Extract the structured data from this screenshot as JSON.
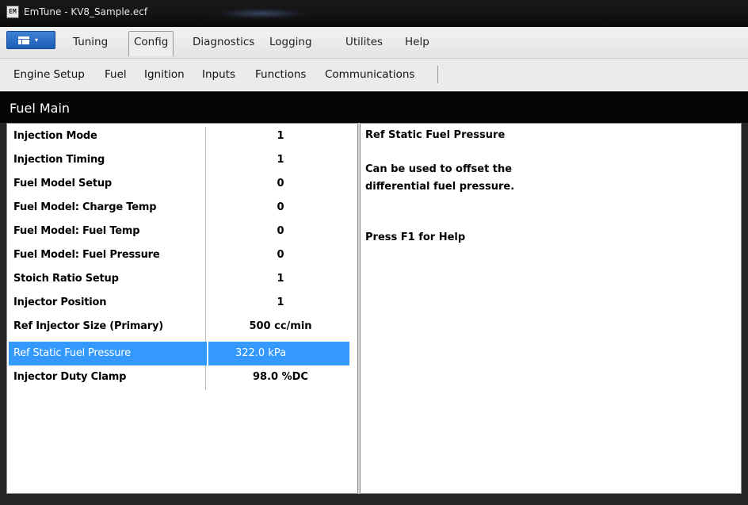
{
  "window": {
    "icon_text": "EM",
    "title": "EmTune  -  KV8_Sample.ecf"
  },
  "ribbon": {
    "app_menu": {
      "icon": "document-menu-icon",
      "caret": "▾",
      "color": "#2a6fcf"
    },
    "tabs": [
      {
        "label": "Tuning",
        "active": false
      },
      {
        "label": "Config",
        "active": true
      },
      {
        "label": "Diagnostics",
        "active": false
      },
      {
        "label": "Logging",
        "active": false
      },
      {
        "label": "Utilites",
        "active": false
      },
      {
        "label": "Help",
        "active": false
      }
    ]
  },
  "submenu": {
    "items": [
      {
        "label": "Engine Setup"
      },
      {
        "label": "Fuel"
      },
      {
        "label": "Ignition"
      },
      {
        "label": "Inputs"
      },
      {
        "label": "Functions"
      },
      {
        "label": "Communications"
      }
    ]
  },
  "panel": {
    "title": "Fuel Main"
  },
  "parameters": [
    {
      "name": "Injection Mode",
      "value": "1"
    },
    {
      "name": "Injection Timing",
      "value": "1"
    },
    {
      "name": "Fuel Model Setup",
      "value": "0"
    },
    {
      "name": "Fuel Model: Charge Temp",
      "value": "0"
    },
    {
      "name": "Fuel Model: Fuel Temp",
      "value": "0"
    },
    {
      "name": "Fuel Model: Fuel Pressure",
      "value": "0"
    },
    {
      "name": "Stoich Ratio Setup",
      "value": "1"
    },
    {
      "name": "Injector Position",
      "value": "1"
    },
    {
      "name": "Ref Injector Size (Primary)",
      "value": "500 cc/min"
    },
    {
      "name": "Ref Static Fuel Pressure",
      "value": "322.0 kPa",
      "selected": true
    },
    {
      "name": "Injector Duty Clamp",
      "value": "98.0 %DC"
    }
  ],
  "help": {
    "title": "Ref Static Fuel Pressure",
    "line1": "Can be used to offset the",
    "line2": "differential fuel pressure.",
    "line3": "Press F1 for Help"
  },
  "colors": {
    "selection": "#3399ff",
    "header_bg": "#050505",
    "accent": "#2a6fcf"
  }
}
